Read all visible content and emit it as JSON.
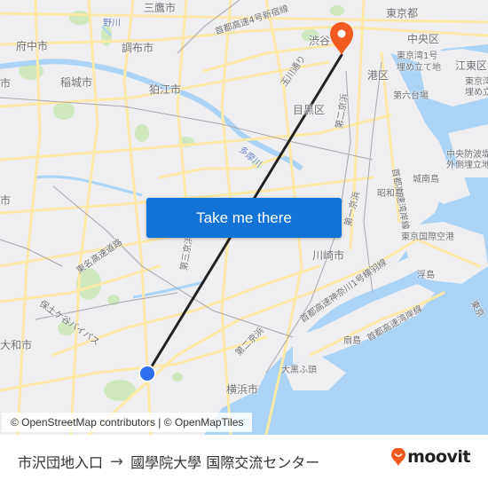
{
  "map": {
    "labels": {
      "mitaka": "三鷹市",
      "fuchu": "府中市",
      "chofu": "調布市",
      "inagi": "稲城市",
      "komae": "狛江市",
      "city_left": "市",
      "city_left2": "市",
      "shibuya": "渋谷",
      "tokyo_to": "東京都",
      "chuo_ku": "中央区",
      "minato_ku": "港区",
      "koto_ku": "江東区",
      "reclaimed1_a": "東京湾1号",
      "reclaimed1_b": "埋め立て地",
      "reclaimed2_a": "東京湾",
      "reclaimed2_b": "埋め立",
      "daiba": "第六台場",
      "meguro_ku": "目黒区",
      "tamagawa_dori": "玉川通り",
      "shuto_4": "首都高速4号新宿線",
      "tamagawa": "多摩川",
      "daini_keihin": "第二京浜",
      "daiichi_keihin": "第一京浜",
      "shuto_wangan": "首都高速湾岸線",
      "chuo_bohatei_a": "中央防波堤",
      "chuo_bohatei_b": "外側埋立地",
      "jonanjima": "城南島",
      "showajima": "昭和島",
      "haneda": "東京国際空港",
      "kawasaki": "川崎市",
      "ukishima": "浮島",
      "shuto_k1": "首都高速神奈川1号横羽線",
      "shuto_wangan2": "首都高速湾岸線",
      "ogishima": "扇島",
      "daikoku": "大黒ふ頭",
      "yokohama": "横浜市",
      "tomei": "東名高速道路",
      "hodogaya": "保土ケ谷バイパス",
      "yamato": "大和市",
      "daisan_keihin": "第三京浜",
      "daini_keihin2": "第二京浜",
      "yoko_tokyo": "東京",
      "no_river": "野川"
    },
    "attribution": "© OpenStreetMap contributors | © OpenMapTiles",
    "cta_button": "Take me there",
    "colors": {
      "route_line": "#222222",
      "origin_marker": "#2d6ff0",
      "destination_pin": "#f25a1f",
      "button": "#1273d6",
      "water": "#aad3f5",
      "road": "#fde9a6"
    }
  },
  "footer": {
    "origin": "市沢団地入口",
    "arrow": "→",
    "destination": "國學院大學 国際交流センター",
    "brand": "moovit",
    "brand_color": "#f25a1f"
  }
}
